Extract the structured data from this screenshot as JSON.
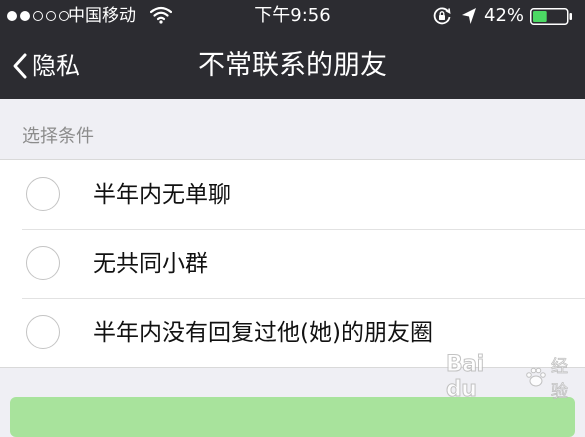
{
  "status_bar": {
    "carrier": "中国移动",
    "time": "下午9:56",
    "battery_percent": "42%",
    "battery_level": 0.42,
    "signal_bars": 2,
    "icons": [
      "signal-dots-icon",
      "wifi-icon",
      "rotation-lock-icon",
      "location-arrow-icon",
      "battery-icon"
    ],
    "battery_color": "#4cd964"
  },
  "nav": {
    "back_label": "隐私",
    "title": "不常联系的朋友"
  },
  "section": {
    "header": "选择条件",
    "options": [
      {
        "label": "半年内无单聊",
        "selected": false
      },
      {
        "label": "无共同小群",
        "selected": false
      },
      {
        "label": "半年内没有回复过他(她)的朋友圈",
        "selected": false
      }
    ]
  },
  "watermark": {
    "brand": "Bai du",
    "sub": "经验"
  },
  "colors": {
    "nav_background": "#2c2c31",
    "page_background": "#efeff4",
    "confirm_button": "#a8e39c"
  }
}
